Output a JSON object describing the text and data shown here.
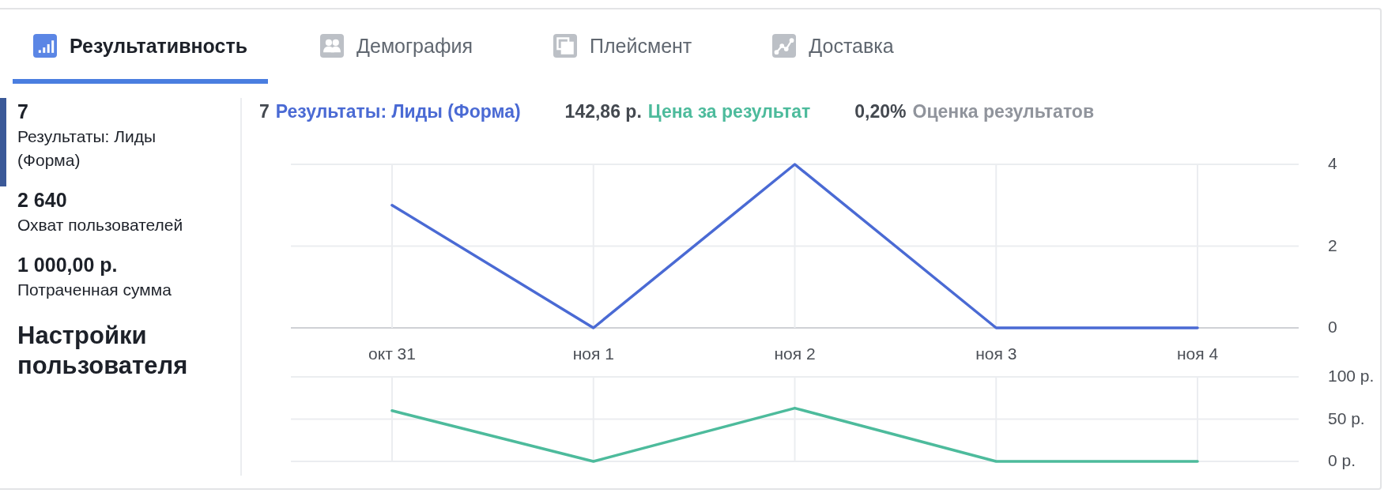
{
  "tabs": [
    {
      "label": "Результативность",
      "selected": true
    },
    {
      "label": "Демография",
      "selected": false
    },
    {
      "label": "Плейсмент",
      "selected": false
    },
    {
      "label": "Доставка",
      "selected": false
    }
  ],
  "summary": [
    {
      "value": "7",
      "label": "Результаты: Лиды (Форма)",
      "selected": true
    },
    {
      "value": "2 640",
      "label": "Охват пользователей",
      "selected": false
    },
    {
      "value": "1 000,00 р.",
      "label": "Потраченная сумма",
      "selected": false
    }
  ],
  "settings_title": "Настройки пользователя",
  "legend": [
    {
      "value": "7",
      "label": "Результаты: Лиды (Форма)",
      "color": "#4a6ad4"
    },
    {
      "value": "142,86 р.",
      "label": "Цена за результат",
      "color": "#4dbb9c"
    },
    {
      "value": "0,20%",
      "label": "Оценка результатов",
      "color": "#90949c"
    }
  ],
  "charts": [
    {
      "chart_data": {
        "type": "line",
        "categories": [
          "окт 31",
          "ноя 1",
          "ноя 2",
          "ноя 3",
          "ноя 4"
        ],
        "series": [
          {
            "color": "#4a6ad4",
            "values": [
              3,
              0,
              4,
              0,
              0
            ]
          }
        ],
        "grid": true,
        "ylim": [
          0,
          4
        ],
        "yticks": [
          0,
          2,
          4
        ]
      }
    },
    {
      "chart_data": {
        "type": "line",
        "series": [
          {
            "color": "#4dbb9c",
            "values": [
              60,
              0,
              63,
              0,
              0
            ]
          }
        ],
        "grid": true,
        "ylim": [
          0,
          100
        ],
        "yticks": [
          {
            "value": 0,
            "label": "0 р."
          },
          {
            "value": 50,
            "label": "50 р."
          },
          {
            "value": 100,
            "label": "100 р."
          }
        ]
      }
    }
  ]
}
